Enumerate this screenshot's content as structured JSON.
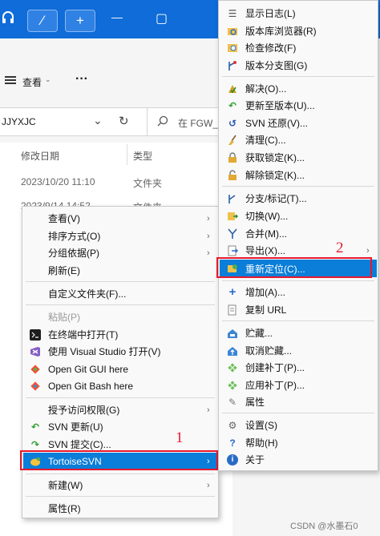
{
  "titlebar": {
    "headset_icon": "headset-icon",
    "wand_glyph": "⁄",
    "plus_glyph": "+",
    "min_glyph": "—",
    "restore_glyph": "▢"
  },
  "toolbar": {
    "view_label": "查看",
    "more_label": "···"
  },
  "address": {
    "path": "JJYXJC",
    "search_placeholder": "在 FGW_"
  },
  "filelist": {
    "col_date": "修改日期",
    "col_type": "类型",
    "rows": [
      {
        "date": "2023/10/20 11:10",
        "type": "文件夹"
      },
      {
        "date": "2023/9/14 14:52",
        "type": "文件夹"
      }
    ]
  },
  "context_menu": {
    "items": [
      {
        "label": "查看(V)",
        "arrow": "›"
      },
      {
        "label": "排序方式(O)",
        "arrow": "›"
      },
      {
        "label": "分组依据(P)",
        "arrow": "›"
      },
      {
        "label": "刷新(E)"
      },
      {
        "label": "自定义文件夹(F)..."
      },
      {
        "label": "粘贴(P)"
      },
      {
        "label": "在终端中打开(T)"
      },
      {
        "label": "使用 Visual Studio 打开(V)"
      },
      {
        "label": "Open Git GUI here"
      },
      {
        "label": "Open Git Bash here"
      },
      {
        "label": "授予访问权限(G)",
        "arrow": "›"
      },
      {
        "label": "SVN 更新(U)"
      },
      {
        "label": "SVN 提交(C)..."
      },
      {
        "label": "TortoiseSVN",
        "arrow": "›"
      },
      {
        "label": "新建(W)",
        "arrow": "›"
      },
      {
        "label": "属性(R)"
      }
    ]
  },
  "svn_menu": {
    "items": [
      {
        "label": "显示日志(L)"
      },
      {
        "label": "版本库浏览器(R)"
      },
      {
        "label": "检查修改(F)"
      },
      {
        "label": "版本分支图(G)"
      },
      {
        "label": "解决(O)..."
      },
      {
        "label": "更新至版本(U)..."
      },
      {
        "label": "SVN 还原(V)..."
      },
      {
        "label": "清理(C)..."
      },
      {
        "label": "获取锁定(K)..."
      },
      {
        "label": "解除锁定(K)..."
      },
      {
        "label": "分支/标记(T)..."
      },
      {
        "label": "切换(W)..."
      },
      {
        "label": "合并(M)..."
      },
      {
        "label": "导出(X)...",
        "arrow": "›"
      },
      {
        "label": "重新定位(C)..."
      },
      {
        "label": "增加(A)..."
      },
      {
        "label": "复制 URL"
      },
      {
        "label": "贮藏..."
      },
      {
        "label": "取消贮藏..."
      },
      {
        "label": "创建补丁(P)..."
      },
      {
        "label": "应用补丁(P)..."
      },
      {
        "label": "属性"
      },
      {
        "label": "设置(S)"
      },
      {
        "label": "帮助(H)"
      },
      {
        "label": "关于"
      }
    ]
  },
  "annotations": {
    "one": "1",
    "two": "2"
  },
  "watermark": "CSDN @水墨石0",
  "colors": {
    "titlebar": "#0f6cd8",
    "highlight": "#0a7ed8",
    "annotation_red": "#e8192c"
  }
}
